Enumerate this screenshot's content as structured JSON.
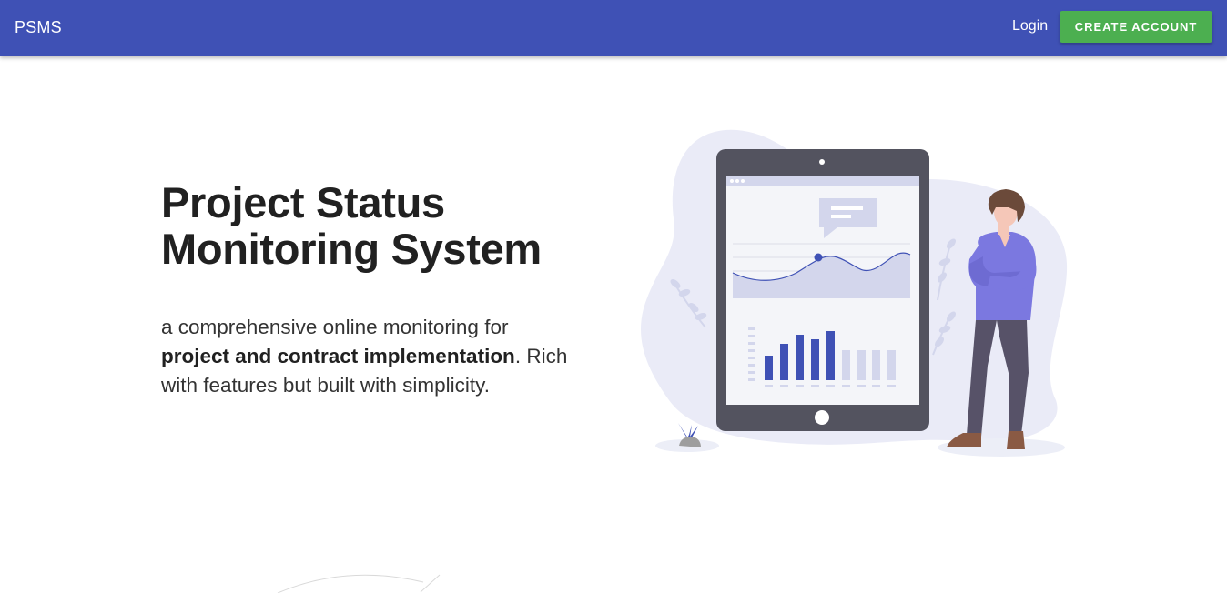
{
  "header": {
    "brand": "PSMS",
    "login_label": "Login",
    "create_account_label": "CREATE ACCOUNT"
  },
  "hero": {
    "title_line1": "Project Status",
    "title_line2": "Monitoring System",
    "description_part1": "a comprehensive online monitoring for",
    "description_bold": "project and contract implementation",
    "description_part2": ". Rich with features but built with simplicity."
  },
  "colors": {
    "primary": "#3f51b5",
    "accent_green": "#4caf50",
    "illustration_accent": "#3f51b5",
    "person_shirt": "#7b78e0"
  },
  "icons": {
    "illustration": "tablet-dashboard-person-illustration"
  }
}
